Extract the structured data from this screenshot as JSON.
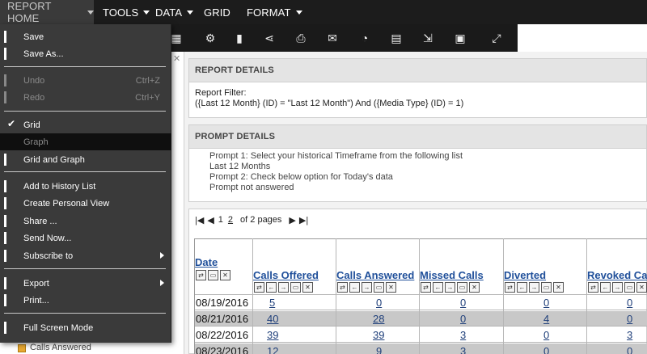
{
  "menubar": {
    "items": [
      {
        "label": "REPORT HOME"
      },
      {
        "label": "TOOLS"
      },
      {
        "label": "DATA"
      },
      {
        "label": "GRID"
      },
      {
        "label": "FORMAT"
      }
    ]
  },
  "toolbar": {
    "icons": [
      "table-icon",
      "gear-export-icon",
      "bookmark-icon",
      "share-icon",
      "print-icon",
      "send-icon",
      "schedule-icon",
      "grid-icon",
      "export-icon",
      "pdf-icon",
      "fullscreen-icon"
    ]
  },
  "dropdown": {
    "items": [
      {
        "label": "Save",
        "shortcut": "",
        "enabled": true
      },
      {
        "label": "Save As...",
        "shortcut": "",
        "enabled": true
      },
      {
        "label": "Undo",
        "shortcut": "Ctrl+Z",
        "enabled": false
      },
      {
        "label": "Redo",
        "shortcut": "Ctrl+Y",
        "enabled": false
      },
      {
        "label": "Grid",
        "shortcut": "",
        "enabled": true,
        "checked": true
      },
      {
        "label": "Graph",
        "shortcut": "",
        "enabled": false,
        "highlighted": true
      },
      {
        "label": "Grid and Graph",
        "shortcut": "",
        "enabled": true
      },
      {
        "label": "Add to History List",
        "shortcut": "",
        "enabled": true
      },
      {
        "label": "Create Personal View",
        "shortcut": "",
        "enabled": true
      },
      {
        "label": "Share ...",
        "shortcut": "",
        "enabled": true
      },
      {
        "label": "Send Now...",
        "shortcut": "",
        "enabled": true
      },
      {
        "label": "Subscribe to",
        "shortcut": "",
        "enabled": true,
        "submenu": true
      },
      {
        "label": "Export",
        "shortcut": "",
        "enabled": true,
        "submenu": true
      },
      {
        "label": "Print...",
        "shortcut": "",
        "enabled": true
      },
      {
        "label": "Full Screen Mode",
        "shortcut": "",
        "enabled": true
      }
    ]
  },
  "report_details": {
    "title": "REPORT DETAILS",
    "filter_label": "Report Filter:",
    "filter_value": "({Last 12 Month} (ID) = \"Last 12 Month\") And ({Media Type} (ID) = 1)"
  },
  "prompt_details": {
    "title": "PROMPT DETAILS",
    "lines": [
      "Prompt 1: Select your historical Timeframe from the following list",
      "Last 12 Months",
      "Prompt 2:  Check below option for Today's data",
      "Prompt not answered"
    ]
  },
  "pager": {
    "page1": "1",
    "page2": "2",
    "summary": "of 2 pages"
  },
  "grid": {
    "columns": [
      "Date",
      "Calls Offered",
      "Calls Answered",
      "Missed Calls",
      "Diverted",
      "Revoked Ca"
    ],
    "rows": [
      {
        "date": "08/19/2016",
        "offered": "5",
        "answered": "0",
        "missed": "0",
        "diverted": "0",
        "revoked": "0"
      },
      {
        "date": "08/21/2016",
        "offered": "40",
        "answered": "28",
        "missed": "0",
        "diverted": "4",
        "revoked": "0"
      },
      {
        "date": "08/22/2016",
        "offered": "39",
        "answered": "39",
        "missed": "3",
        "diverted": "0",
        "revoked": "3"
      },
      {
        "date": "08/23/2016",
        "offered": "12",
        "answered": "9",
        "missed": "3",
        "diverted": "0",
        "revoked": "0"
      }
    ]
  },
  "objects_panel": {
    "item_label": "Calls Answered"
  },
  "colors": {
    "menubar_bg": "#1c1c1c",
    "dropdown_bg": "#3a3a3a",
    "link_blue": "#1f4f9a",
    "alt_row": "#c8c8c8"
  }
}
